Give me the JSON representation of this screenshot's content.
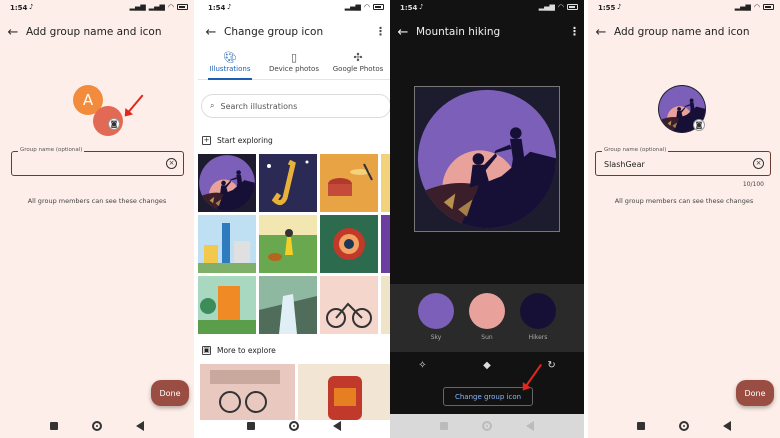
{
  "panel1": {
    "status": {
      "time": "1:54"
    },
    "title": "Add group name and icon",
    "avatar_letter": "A",
    "field": {
      "label": "Group name (optional)",
      "value": ""
    },
    "hint": "All group members can see these changes",
    "done_label": "Done"
  },
  "panel2": {
    "status": {
      "time": "1:54"
    },
    "title": "Change group icon",
    "tabs": [
      {
        "label": "Illustrations",
        "icon": "palette-icon",
        "active": true
      },
      {
        "label": "Device photos",
        "icon": "phone-icon",
        "active": false
      },
      {
        "label": "Google Photos",
        "icon": "pinwheel-icon",
        "active": false
      }
    ],
    "search_placeholder": "Search illustrations",
    "start_exploring": "Start exploring",
    "more_to_explore": "More to explore"
  },
  "panel3": {
    "status": {
      "time": "1:54"
    },
    "title": "Mountain hiking",
    "swatches": [
      {
        "label": "Sky",
        "color": "#7b5fb8"
      },
      {
        "label": "Sun",
        "color": "#e8a29b"
      },
      {
        "label": "Hikers",
        "color": "#161036"
      }
    ],
    "change_label": "Change group icon"
  },
  "panel4": {
    "status": {
      "time": "1:55"
    },
    "title": "Add group name and icon",
    "field": {
      "label": "Group name (optional)",
      "value": "SlashGear"
    },
    "counter": "10/100",
    "hint": "All group members can see these changes",
    "done_label": "Done"
  },
  "colors": {
    "accent": "#1a5fb4",
    "done_bg": "#9a4e43",
    "panel_bg": "#fdeee9",
    "arrow": "#e0281d"
  }
}
